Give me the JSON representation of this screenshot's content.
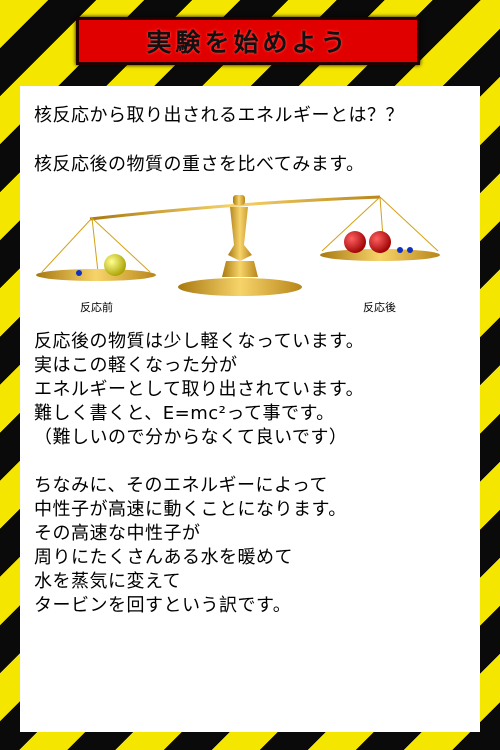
{
  "banner": {
    "title": "実験を始めよう"
  },
  "intro": {
    "line1": "核反応から取り出されるエネルギーとは？？",
    "line2": "核反応後の物質の重さを比べてみます。"
  },
  "scale": {
    "label_before": "反応前",
    "label_after": "反応後"
  },
  "para1": [
    "反応後の物質は少し軽くなっています。",
    "実はこの軽くなった分が",
    "エネルギーとして取り出されています。",
    "難しく書くと、E=mc²って事です。",
    "（難しいので分からなくて良いです）"
  ],
  "para2": [
    "ちなみに、そのエネルギーによって",
    "中性子が高速に動くことになります。",
    "その高速な中性子が",
    "周りにたくさんある水を暖めて",
    "水を蒸気に変えて",
    "タービンを回すという訳です。"
  ],
  "colors": {
    "stripe_yellow": "#f5e600",
    "stripe_black": "#0a0a0a",
    "banner_red": "#e00000",
    "gold": "#d4a017"
  }
}
